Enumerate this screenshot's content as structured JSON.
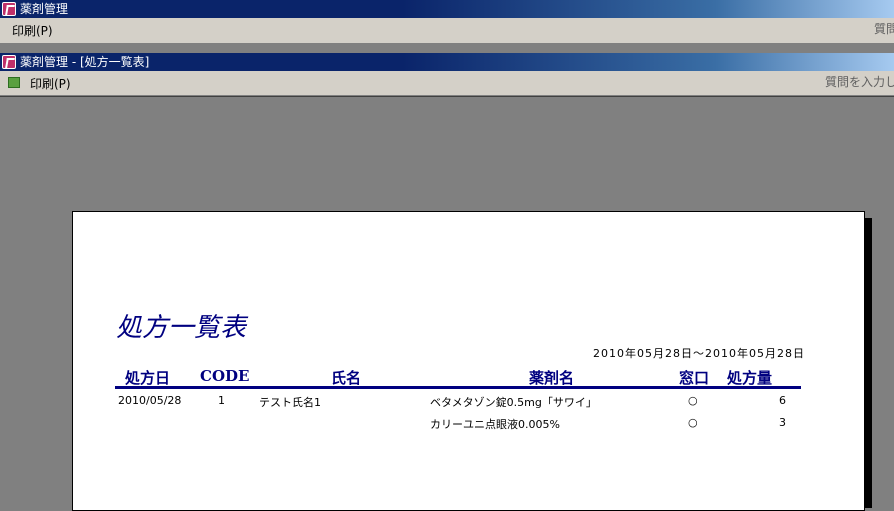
{
  "outer_window": {
    "title": "薬剤管理",
    "menu_print": "印刷(P)",
    "help_placeholder": "質問"
  },
  "child_window": {
    "title": "薬剤管理 - [処方一覧表]",
    "menu_print": "印刷(P)",
    "help_placeholder": "質問を入力し"
  },
  "report": {
    "title": "処方一覧表",
    "date_range": "2010年05月28日～2010年05月28日",
    "columns": [
      "処方日",
      "CODE",
      "氏名",
      "薬剤名",
      "窓口",
      "処方量"
    ],
    "rows": [
      {
        "date": "2010/05/28",
        "code": "1",
        "name": "テスト氏名1",
        "drug": "ベタメタゾン錠0.5mg「サワイ」",
        "window": "○",
        "amount": "6"
      },
      {
        "date": "",
        "code": "",
        "name": "",
        "drug": "カリーユニ点眼液0.005%",
        "window": "○",
        "amount": "3"
      }
    ]
  },
  "icons": {
    "app": "access-app-icon",
    "print": "print-icon"
  }
}
